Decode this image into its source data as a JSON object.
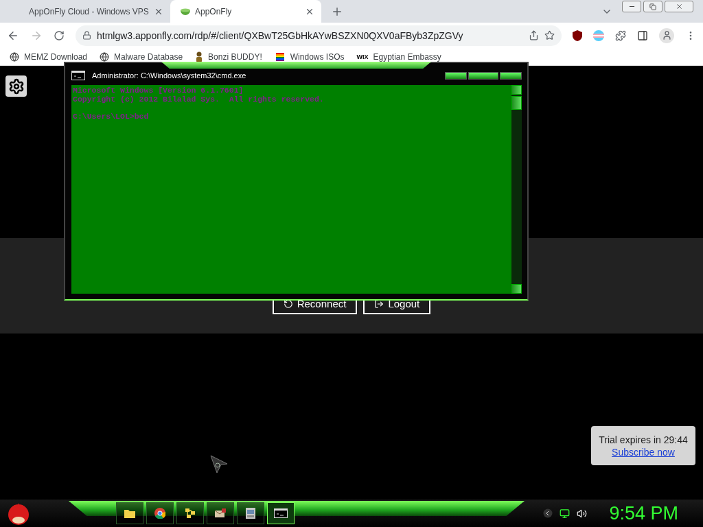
{
  "browser": {
    "tabs": [
      {
        "title": "AppOnFly Cloud - Windows VPS",
        "selected": false
      },
      {
        "title": "AppOnFly",
        "selected": true
      }
    ],
    "url": "htmlgw3.apponfly.com/rdp/#/client/QXBwT25GbHkAYwBSZXN0QXV0aFByb3ZpZGVy",
    "bookmarks": [
      {
        "label": "MEMZ Download",
        "kind": "globe"
      },
      {
        "label": "Malware Database",
        "kind": "globe"
      },
      {
        "label": "Bonzi BUDDY!",
        "kind": "figure"
      },
      {
        "label": "Windows ISOs",
        "kind": "flag"
      },
      {
        "label": "Egyptian Embassy",
        "kind": "wordmark",
        "logo": "WIX"
      }
    ]
  },
  "page": {
    "buttons": [
      {
        "label": "Reconnect",
        "kind": "reconnect"
      },
      {
        "label": "Logout",
        "kind": "logout"
      }
    ],
    "toast": {
      "message": "Trial expires in 29:44",
      "link": "Subscribe now"
    }
  },
  "remote": {
    "console": {
      "title": "Administrator: C:\\Windows\\system32\\cmd.exe",
      "output": "Microsoft Windows [Version 6.1.7601]\nCopyright (c) 2012 Bilalad Sys.  All rights reserved.\n\nC:\\Users\\LOL>bcd"
    },
    "taskbar": {
      "apps": [
        {
          "kind": "folder",
          "selected": false
        },
        {
          "kind": "browser",
          "selected": false
        },
        {
          "kind": "network",
          "selected": false
        },
        {
          "kind": "mail",
          "selected": false
        },
        {
          "kind": "window",
          "selected": false
        },
        {
          "kind": "console",
          "selected": true
        }
      ],
      "clock": "9:54 PM"
    }
  }
}
